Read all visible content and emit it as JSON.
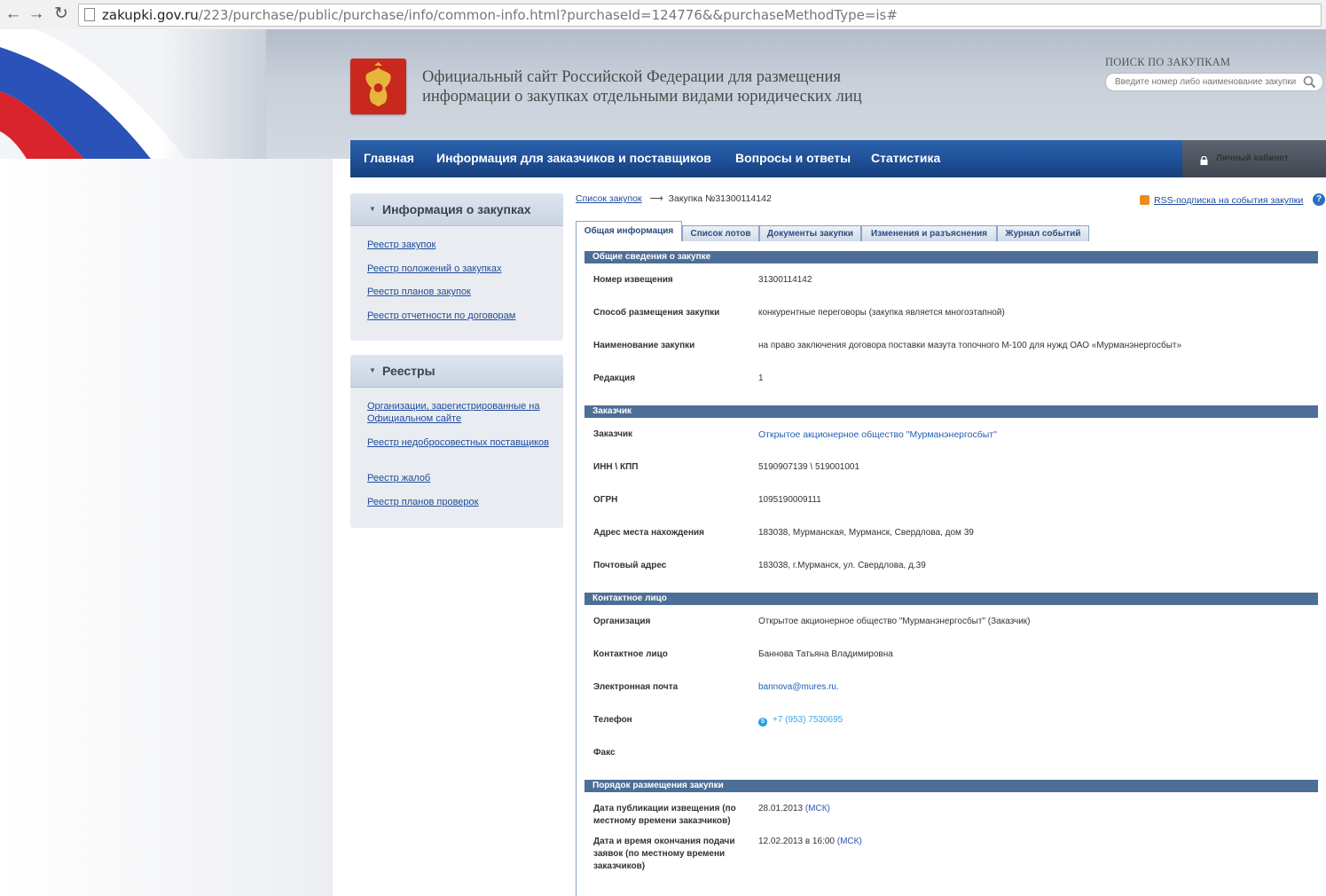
{
  "browser": {
    "url_host": "zakupki.gov.ru",
    "url_path": "/223/purchase/public/purchase/info/common-info.html?purchaseId=124776&&purchaseMethodType=is#"
  },
  "header": {
    "site_title_line1": "Официальный сайт Российской Федерации для размещения",
    "site_title_line2": "информации о закупках отдельными видами юридических лиц",
    "search_label": "ПОИСК ПО ЗАКУПКАМ",
    "search_placeholder": "Введите номер либо наименование закупки"
  },
  "nav": {
    "items": [
      "Главная",
      "Информация для заказчиков и поставщиков",
      "Вопросы и ответы",
      "Статистика"
    ],
    "cabinet": "Личный кабинет"
  },
  "sidebar": {
    "panels": [
      {
        "title": "Информация о закупках",
        "links": [
          "Реестр закупок",
          "Реестр положений о закупках",
          "Реестр планов закупок",
          "Реестр отчетности по договорам"
        ]
      },
      {
        "title": "Реестры",
        "links": [
          "Организации, зарегистрированные на Официальном сайте",
          "Реестр недобросовестных поставщиков",
          "Реестр жалоб",
          "Реестр планов проверок"
        ]
      }
    ]
  },
  "breadcrumb": {
    "link": "Список закупок",
    "arrow": "⟶",
    "current": "Закупка №31300114142"
  },
  "rss": {
    "label": "RSS-подписка на события закупки",
    "help": "?"
  },
  "tabs": [
    "Общая информация",
    "Список лотов",
    "Документы закупки",
    "Изменения и разъяснения",
    "Журнал событий"
  ],
  "sections": {
    "general": {
      "title": "Общие сведения о закупке",
      "rows": [
        {
          "label": "Номер извещения",
          "value": "31300114142"
        },
        {
          "label": "Способ размещения закупки",
          "value": "конкурентные переговоры (закупка является многоэтапной)"
        },
        {
          "label": "Наименование закупки",
          "value": "на право заключения договора поставки мазута топочного М-100 для нужд ОАО «Мурманэнергосбыт»"
        },
        {
          "label": "Редакция",
          "value": "1"
        }
      ]
    },
    "customer": {
      "title": "Заказчик",
      "rows": [
        {
          "label": "Заказчик",
          "value": "Открытое акционерное общество \"Мурманэнергосбыт\""
        },
        {
          "label": "ИНН \\ КПП",
          "value": "5190907139  \\  519001001"
        },
        {
          "label": "ОГРН",
          "value": "1095190009111"
        },
        {
          "label": "Адрес места нахождения",
          "value": "183038, Мурманская, Мурманск, Свердлова, дом 39"
        },
        {
          "label": "Почтовый адрес",
          "value": "183038, г.Мурманск, ул. Свердлова, д.39"
        }
      ]
    },
    "contact": {
      "title": "Контактное лицо",
      "rows": [
        {
          "label": "Организация",
          "value": "Открытое акционерное общество \"Мурманэнергосбыт\" (Заказчик)"
        },
        {
          "label": "Контактное лицо",
          "value": "Баннова Татьяна Владимировна"
        },
        {
          "label": "Электронная почта",
          "value": "bannova@mures.ru."
        },
        {
          "label": "Телефон",
          "value": "+7 (953) 7530695"
        },
        {
          "label": "Факс",
          "value": ""
        }
      ]
    },
    "order": {
      "title": "Порядок размещения закупки",
      "rows": [
        {
          "label": "Дата публикации извещения (по местному времени заказчиков)",
          "value": "28.01.2013",
          "tz": "(МСК)"
        },
        {
          "label": "Дата и время окончания подачи заявок (по местному времени заказчиков)",
          "value": "12.02.2013 в 16:00",
          "tz": "(МСК)"
        }
      ]
    }
  },
  "colors": {
    "nav_blue": "#1f4f96",
    "section_bar": "#4d6e96",
    "link": "#1f4c9c",
    "emblem_red": "#c8281d"
  }
}
